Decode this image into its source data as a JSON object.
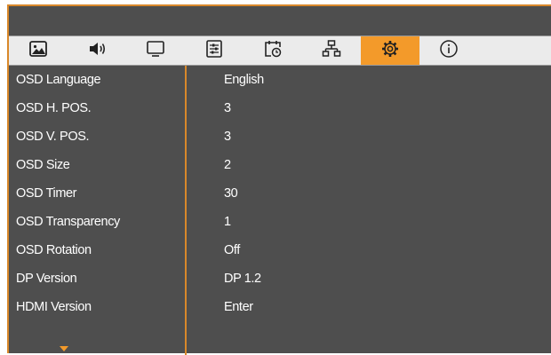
{
  "tabs": [
    {
      "icon": "picture-icon",
      "active": false
    },
    {
      "icon": "sound-icon",
      "active": false
    },
    {
      "icon": "display-icon",
      "active": false
    },
    {
      "icon": "adjust-icon",
      "active": false
    },
    {
      "icon": "schedule-icon",
      "active": false
    },
    {
      "icon": "network-icon",
      "active": false
    },
    {
      "icon": "settings-gear-icon",
      "active": true
    },
    {
      "icon": "info-icon",
      "active": false
    }
  ],
  "colors": {
    "accent": "#f39a2a",
    "panel": "#4e4e4e",
    "tabbar": "#ebebeb"
  },
  "menu": {
    "rows": [
      {
        "label": "OSD Language",
        "value": "English"
      },
      {
        "label": "OSD H. POS.",
        "value": "3"
      },
      {
        "label": "OSD V. POS.",
        "value": "3"
      },
      {
        "label": "OSD Size",
        "value": "2"
      },
      {
        "label": "OSD Timer",
        "value": "30"
      },
      {
        "label": "OSD Transparency",
        "value": "1"
      },
      {
        "label": "OSD Rotation",
        "value": "Off"
      },
      {
        "label": "DP Version",
        "value": "DP 1.2"
      },
      {
        "label": "HDMI Version",
        "value": "Enter"
      }
    ]
  }
}
